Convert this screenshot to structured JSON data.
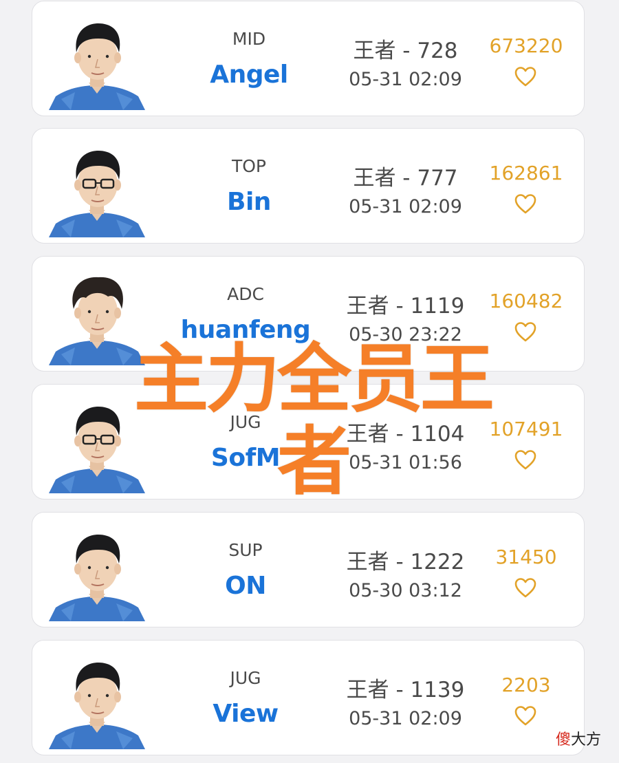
{
  "players": [
    {
      "position": "MID",
      "name": "Angel",
      "rank": "王者 - 728",
      "time": "05-31 02:09",
      "likes": "673220"
    },
    {
      "position": "TOP",
      "name": "Bin",
      "rank": "王者 - 777",
      "time": "05-31 02:09",
      "likes": "162861"
    },
    {
      "position": "ADC",
      "name": "huanfeng",
      "rank": "王者 - 1119",
      "time": "05-30 23:22",
      "likes": "160482"
    },
    {
      "position": "JUG",
      "name": "SofM",
      "rank": "王者 - 1104",
      "time": "05-31 01:56",
      "likes": "107491"
    },
    {
      "position": "SUP",
      "name": "ON",
      "rank": "王者 - 1222",
      "time": "05-30 03:12",
      "likes": "31450"
    },
    {
      "position": "JUG",
      "name": "View",
      "rank": "王者 - 1139",
      "time": "05-31 02:09",
      "likes": "2203"
    }
  ],
  "overlay": {
    "text": "主力全员王者"
  },
  "watermark": {
    "red_part": "傻",
    "black_part": "大方"
  },
  "colors": {
    "name": "#1a73d8",
    "likes": "#e2a228",
    "overlay": "#f57f28",
    "watermark_red": "#d62b1f"
  },
  "icons": {
    "like": "heart-outline-icon",
    "avatar": "player-photo"
  }
}
